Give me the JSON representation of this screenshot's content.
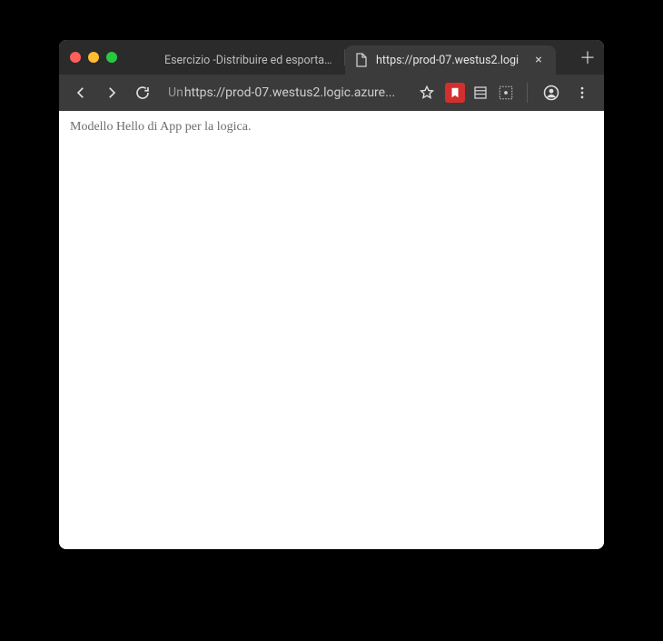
{
  "tabs": [
    {
      "title": "Esercizio -Distribuire ed esportare",
      "active": false,
      "favicon": "microsoft"
    },
    {
      "title": "https://prod-07.westus2.logi",
      "active": true,
      "favicon": "page"
    }
  ],
  "toolbar": {
    "address_prefix": "Un",
    "address": "https://prod-07.westus2.logic.azure..."
  },
  "page": {
    "body_text": "Modello Hello di App per la logica."
  }
}
